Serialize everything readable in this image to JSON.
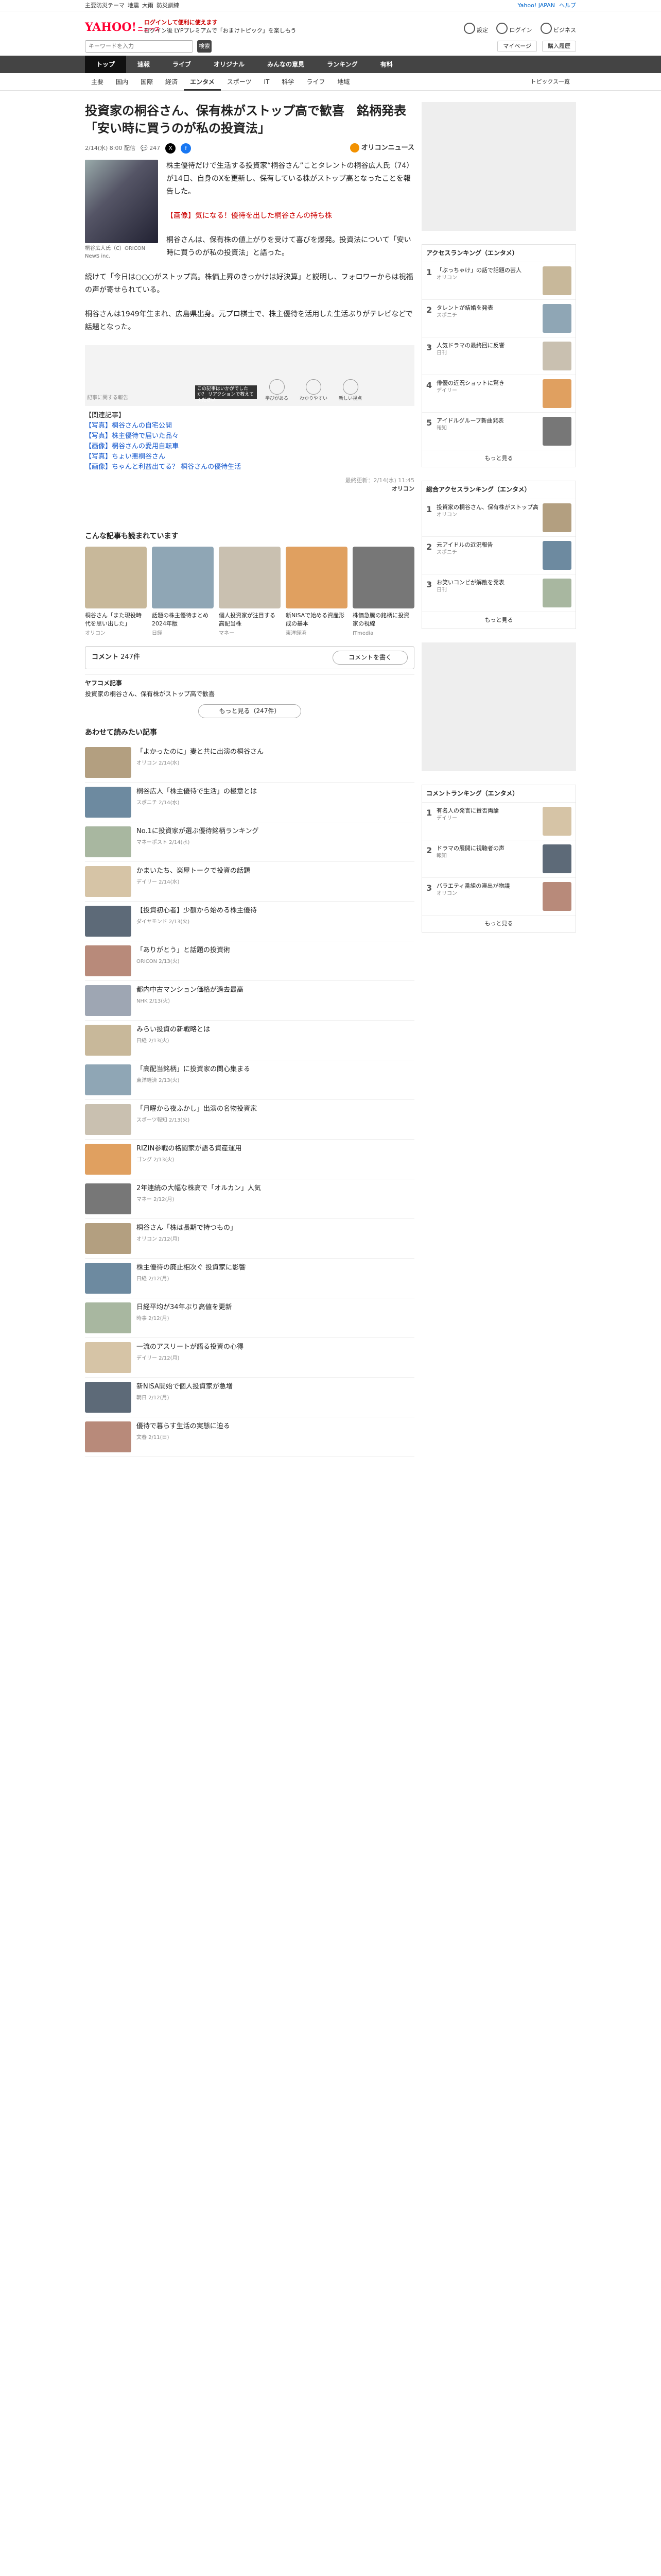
{
  "topbar": {
    "left": [
      "主要防災テーマ",
      "地震",
      "大雨",
      "防災訓練"
    ],
    "right": [
      "Yahoo! JAPAN",
      "ヘルプ"
    ]
  },
  "header": {
    "logo": "YAHOO!",
    "logo_sub": "ニュース",
    "msg1": "ログインして便利に使えます",
    "msg2": "ログイン後 LYPプレミアムで「おまけトピック」を楽しもう",
    "right": [
      "設定",
      "ログイン",
      "ビジネス"
    ]
  },
  "search": {
    "placeholder": "キーワードを入力",
    "button": "検索",
    "right": [
      "マイページ",
      "購入履歴"
    ]
  },
  "nav": [
    "トップ",
    "速報",
    "ライブ",
    "オリジナル",
    "みんなの意見",
    "ランキング",
    "有料"
  ],
  "subnav": [
    "主要",
    "国内",
    "国際",
    "経済",
    "エンタメ",
    "スポーツ",
    "IT",
    "科学",
    "ライフ",
    "地域"
  ],
  "subnav_more": "トピックス一覧",
  "article": {
    "title": "投資家の桐谷さん、保有株がストップ高で歓喜　銘柄発表「安い時に買うのが私の投資法」",
    "date": "2/14(水) 8:00 配信",
    "comments_count": "247",
    "source": "オリコンニュース",
    "photo_caption": "桐谷広人氏（C）ORICON NewS inc.",
    "p1": "株主優待だけで生活する投資家“桐谷さん”ことタレントの桐谷広人氏（74）が14日、自身のXを更新し、保有している株がストップ高となったことを報告した。",
    "p2": "【画像】気になる！優待を出した桐谷さんの持ち株",
    "p3": "桐谷さんは、保有株の値上がりを受けて喜びを爆発。投資法について「安い時に買うのが私の投資法」と語った。",
    "p4": "続けて「今日は○○○がストップ高。株価上昇のきっかけは好決算」と説明し、フォロワーからは祝福の声が寄せられている。",
    "p5": "桐谷さんは1949年生まれ、広島県出身。元プロ棋士で、株主優待を活用した生活ぶりがテレビなどで話題となった。",
    "img_caption": "記事に関する報告",
    "img_bar": "この記事はいかがでしたか？ リアクションで教えてください",
    "img_icons": [
      "学びがある",
      "わかりやすい",
      "新しい視点"
    ],
    "links": [
      "【関連記事】",
      "【写真】桐谷さんの自宅公開",
      "【写真】株主優待で届いた品々",
      "【画像】桐谷さんの愛用自転車",
      "【写真】ちょい悪桐谷さん",
      "【画像】ちゃんと利益出てる？ 桐谷さんの優待生活"
    ],
    "rights": "最終更新：2/14(水) 11:45",
    "rights_src": "オリコン"
  },
  "related": {
    "title": "こんな記事も読まれています",
    "cards": [
      {
        "text": "桐谷さん「また現役時代を思い出した」",
        "src": "オリコン",
        "color": "c1"
      },
      {
        "text": "話題の株主優待まとめ 2024年版",
        "src": "日経",
        "color": "c2"
      },
      {
        "text": "個人投資家が注目する高配当株",
        "src": "マネー",
        "color": "c3"
      },
      {
        "text": "新NISAで始める資産形成の基本",
        "src": "東洋経済",
        "color": "c4"
      },
      {
        "text": "株価急騰の銘柄に投資家の視線",
        "src": "ITmedia",
        "color": "c5"
      }
    ]
  },
  "comments": {
    "label": "コメント",
    "count": "247件",
    "button": "コメントを書く",
    "section": "ヤフコメ記事",
    "sub": "投資家の桐谷さん、保有株がストップ高で歓喜",
    "more_btn": "もっと見る（247件）"
  },
  "feed_title": "あわせて読みたい記事",
  "feed": [
    {
      "text": "「よかったのに」妻と共に出演の桐谷さん",
      "src": "オリコン 2/14(水)",
      "color": "c6"
    },
    {
      "text": "桐谷広人「株主優待で生活」の極意とは",
      "src": "スポニチ 2/14(水)",
      "color": "c7"
    },
    {
      "text": "No.1に投資家が選ぶ優待銘柄ランキング",
      "src": "マネーポスト 2/14(水)",
      "color": "c8"
    },
    {
      "text": "かまいたち、楽屋トークで投資の話題",
      "src": "デイリー 2/14(水)",
      "color": "c9"
    },
    {
      "text": "【投資初心者】少額から始める株主優待",
      "src": "ダイヤモンド 2/13(火)",
      "color": "c10"
    },
    {
      "text": "「ありがとう」と話題の投資術",
      "src": "ORICON 2/13(火)",
      "color": "c11"
    },
    {
      "text": "都内中古マンション価格が過去最高",
      "src": "NHK 2/13(火)",
      "color": "c12"
    },
    {
      "text": "みらい投資の新戦略とは",
      "src": "日経 2/13(火)",
      "color": "c1"
    },
    {
      "text": "「高配当銘柄」に投資家の関心集まる",
      "src": "東洋経済 2/13(火)",
      "color": "c2"
    },
    {
      "text": "「月曜から夜ふかし」出演の名物投資家",
      "src": "スポーツ報知 2/13(火)",
      "color": "c3"
    },
    {
      "text": "RIZIN参戦の格闘家が語る資産運用",
      "src": "ゴング 2/13(火)",
      "color": "c4"
    },
    {
      "text": "2年連続の大幅な株高で「オルカン」人気",
      "src": "マネー 2/12(月)",
      "color": "c5"
    },
    {
      "text": "桐谷さん「株は長期で持つもの」",
      "src": "オリコン 2/12(月)",
      "color": "c6"
    },
    {
      "text": "株主優待の廃止相次ぐ 投資家に影響",
      "src": "日経 2/12(月)",
      "color": "c7"
    },
    {
      "text": "日経平均が34年ぶり高値を更新",
      "src": "時事 2/12(月)",
      "color": "c8"
    },
    {
      "text": "一流のアスリートが語る投資の心得",
      "src": "デイリー 2/12(月)",
      "color": "c9"
    },
    {
      "text": "新NISA開始で個人投資家が急増",
      "src": "朝日 2/12(月)",
      "color": "c10"
    },
    {
      "text": "優待で暮らす生活の実態に迫る",
      "src": "文春 2/11(日)",
      "color": "c11"
    }
  ],
  "sidebar": {
    "rank1": {
      "title": "アクセスランキング（エンタメ）",
      "items": [
        {
          "n": "1",
          "t": "「ぶっちゃけ」の話で話題の芸人",
          "s": "オリコン",
          "c": "c1"
        },
        {
          "n": "2",
          "t": "タレントが結婚を発表",
          "s": "スポニチ",
          "c": "c2"
        },
        {
          "n": "3",
          "t": "人気ドラマの最終回に反響",
          "s": "日刊",
          "c": "c3"
        },
        {
          "n": "4",
          "t": "俳優の近況ショットに驚き",
          "s": "デイリー",
          "c": "c4"
        },
        {
          "n": "5",
          "t": "アイドルグループ新曲発表",
          "s": "報知",
          "c": "c5"
        }
      ]
    },
    "rank2": {
      "title": "総合アクセスランキング（エンタメ）",
      "items": [
        {
          "n": "1",
          "t": "投資家の桐谷さん、保有株がストップ高",
          "s": "オリコン",
          "c": "c6"
        },
        {
          "n": "2",
          "t": "元アイドルの近況報告",
          "s": "スポニチ",
          "c": "c7"
        },
        {
          "n": "3",
          "t": "お笑いコンビが解散を発表",
          "s": "日刊",
          "c": "c8"
        }
      ]
    },
    "rank3": {
      "title": "コメントランキング（エンタメ）",
      "items": [
        {
          "n": "1",
          "t": "有名人の発言に賛否両論",
          "s": "デイリー",
          "c": "c9"
        },
        {
          "n": "2",
          "t": "ドラマの展開に視聴者の声",
          "s": "報知",
          "c": "c10"
        },
        {
          "n": "3",
          "t": "バラエティ番組の演出が物議",
          "s": "オリコン",
          "c": "c11"
        }
      ]
    },
    "more": "もっと見る"
  }
}
